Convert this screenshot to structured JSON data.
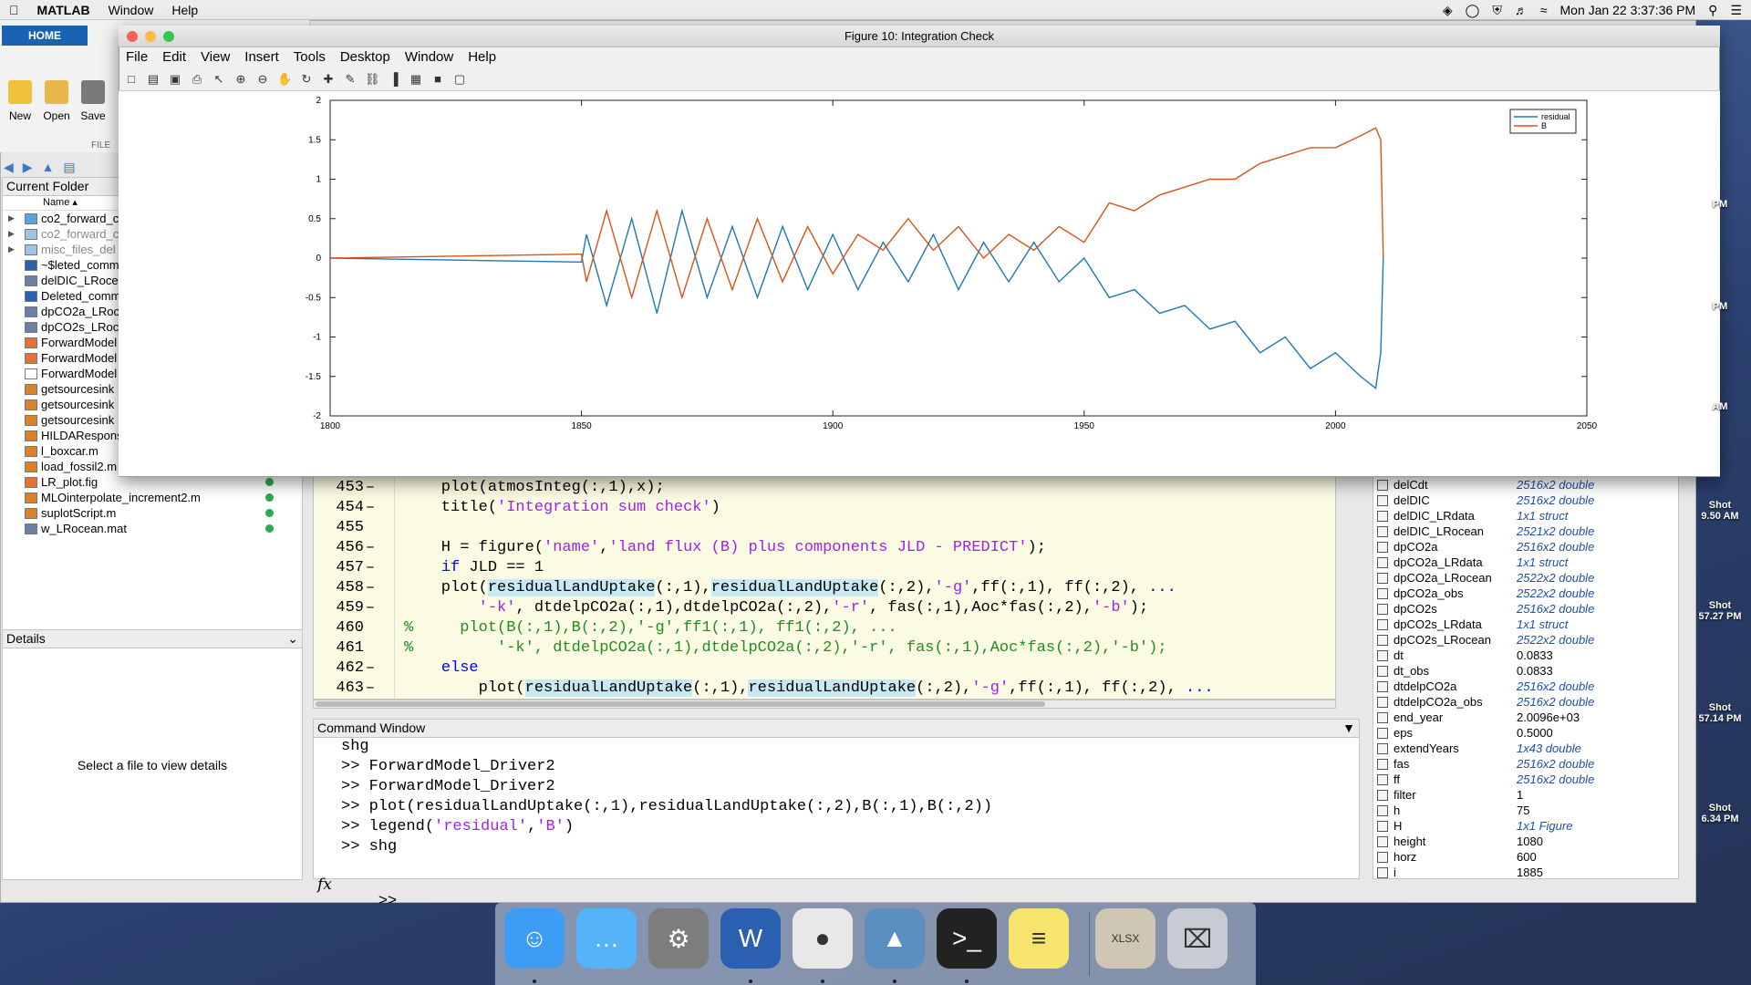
{
  "menubar": {
    "app": "MATLAB",
    "items": [
      "Window",
      "Help"
    ],
    "clock": "Mon Jan 22  3:37:36 PM"
  },
  "toolstrip": {
    "home_tab": "HOME",
    "new": "New",
    "open": "Open",
    "save": "Save",
    "file_section": "FILE"
  },
  "current_folder": {
    "title": "Current Folder",
    "name_header": "Name ▴",
    "files": [
      {
        "name": "co2_forward_c",
        "kind": "folder"
      },
      {
        "name": "co2_forward_c",
        "kind": "folder-gray"
      },
      {
        "name": "misc_files_del",
        "kind": "folder-gray"
      },
      {
        "name": "~$leted_comm",
        "kind": "word"
      },
      {
        "name": "delDIC_LRocea",
        "kind": "mat"
      },
      {
        "name": "Deleted_comm",
        "kind": "word"
      },
      {
        "name": "dpCO2a_LRoc",
        "kind": "mat"
      },
      {
        "name": "dpCO2s_LRoc",
        "kind": "mat"
      },
      {
        "name": "ForwardModel",
        "kind": "fig"
      },
      {
        "name": "ForwardModel",
        "kind": "fig"
      },
      {
        "name": "ForwardModel",
        "kind": "file"
      },
      {
        "name": "getsourcesink",
        "kind": "m"
      },
      {
        "name": "getsourcesink",
        "kind": "m"
      },
      {
        "name": "getsourcesink",
        "kind": "m"
      },
      {
        "name": "HILDARespons",
        "kind": "m"
      },
      {
        "name": "l_boxcar.m",
        "kind": "m"
      },
      {
        "name": "load_fossil2.m",
        "kind": "m"
      },
      {
        "name": "LR_plot.fig",
        "kind": "fig"
      },
      {
        "name": "MLOinterpolate_increment2.m",
        "kind": "m"
      },
      {
        "name": "suplotScript.m",
        "kind": "m"
      },
      {
        "name": "w_LRocean.mat",
        "kind": "mat"
      }
    ],
    "details_title": "Details",
    "details_text": "Select a file to view details"
  },
  "figure": {
    "window_title": "Figure 10: Integration Check",
    "menu": [
      "File",
      "Edit",
      "View",
      "Insert",
      "Tools",
      "Desktop",
      "Window",
      "Help"
    ],
    "toolbar_icons": [
      "new-figure-icon",
      "open-icon",
      "save-icon",
      "print-icon",
      "pointer-icon",
      "zoom-in-icon",
      "zoom-out-icon",
      "pan-icon",
      "rotate-icon",
      "data-cursor-icon",
      "brush-icon",
      "link-icon",
      "colorbar-icon",
      "legend-icon",
      "hide-tools-icon",
      "show-tools-icon"
    ]
  },
  "chart_data": {
    "type": "line",
    "xlim": [
      1800,
      2050
    ],
    "ylim": [
      -2,
      2
    ],
    "x_ticks": [
      "1800",
      "1850",
      "1900",
      "1950",
      "2000",
      "2050"
    ],
    "y_ticks": [
      "2",
      "1.5",
      "1",
      "0.5",
      "0",
      "-0.5",
      "-1",
      "-1.5",
      "-2"
    ],
    "grid": false,
    "legend_position": "top-right",
    "series": [
      {
        "name": "residual",
        "color": "#1f77b4",
        "x": [
          1800,
          1850,
          1851,
          1855,
          1860,
          1865,
          1870,
          1875,
          1880,
          1885,
          1890,
          1895,
          1900,
          1905,
          1910,
          1915,
          1920,
          1925,
          1930,
          1935,
          1940,
          1945,
          1950,
          1955,
          1960,
          1965,
          1970,
          1975,
          1980,
          1985,
          1990,
          1995,
          2000,
          2005,
          2008,
          2009,
          2009.5
        ],
        "y": [
          0,
          -0.05,
          0.3,
          -0.6,
          0.5,
          -0.7,
          0.6,
          -0.5,
          0.4,
          -0.5,
          0.4,
          -0.4,
          0.3,
          -0.4,
          0.2,
          -0.3,
          0.3,
          -0.4,
          0.2,
          -0.3,
          0.2,
          -0.3,
          0.0,
          -0.5,
          -0.4,
          -0.7,
          -0.6,
          -0.9,
          -0.8,
          -1.2,
          -1.0,
          -1.4,
          -1.2,
          -1.5,
          -1.65,
          -1.2,
          0.0
        ]
      },
      {
        "name": "B",
        "color": "#d95319",
        "x": [
          1800,
          1850,
          1851,
          1855,
          1860,
          1865,
          1870,
          1875,
          1880,
          1885,
          1890,
          1895,
          1900,
          1905,
          1910,
          1915,
          1920,
          1925,
          1930,
          1935,
          1940,
          1945,
          1950,
          1955,
          1960,
          1965,
          1970,
          1975,
          1980,
          1985,
          1990,
          1995,
          2000,
          2005,
          2008,
          2009,
          2009.5
        ],
        "y": [
          0,
          0.05,
          -0.3,
          0.6,
          -0.5,
          0.6,
          -0.5,
          0.5,
          -0.4,
          0.5,
          -0.3,
          0.4,
          -0.2,
          0.3,
          0.1,
          0.5,
          0.1,
          0.4,
          0.0,
          0.3,
          0.1,
          0.4,
          0.2,
          0.7,
          0.6,
          0.8,
          0.9,
          1.0,
          1.0,
          1.2,
          1.3,
          1.4,
          1.4,
          1.55,
          1.65,
          1.5,
          0.0
        ]
      }
    ]
  },
  "editor": {
    "lines": [
      {
        "num": "453",
        "segs": [
          {
            "t": "    plot(atmosInteg(:,1),x);",
            "c": ""
          }
        ]
      },
      {
        "num": "454",
        "segs": [
          {
            "t": "    title(",
            "c": ""
          },
          {
            "t": "'Integration sum check'",
            "c": "str"
          },
          {
            "t": ")",
            "c": ""
          }
        ]
      },
      {
        "num": "455",
        "segs": [
          {
            "t": "",
            "c": ""
          }
        ]
      },
      {
        "num": "456",
        "segs": [
          {
            "t": "    H = figure(",
            "c": ""
          },
          {
            "t": "'name'",
            "c": "str"
          },
          {
            "t": ",",
            "c": ""
          },
          {
            "t": "'land flux (B) plus components JLD - PREDICT'",
            "c": "str"
          },
          {
            "t": ");",
            "c": ""
          }
        ]
      },
      {
        "num": "457",
        "segs": [
          {
            "t": "    ",
            "c": ""
          },
          {
            "t": "if",
            "c": "kw"
          },
          {
            "t": " JLD == 1",
            "c": ""
          }
        ]
      },
      {
        "num": "458",
        "segs": [
          {
            "t": "    plot(",
            "c": ""
          },
          {
            "t": "residualLandUptake",
            "c": "hl"
          },
          {
            "t": "(:,1),",
            "c": ""
          },
          {
            "t": "residualLandUptake",
            "c": "hl"
          },
          {
            "t": "(:,2),",
            "c": ""
          },
          {
            "t": "'-g'",
            "c": "str"
          },
          {
            "t": ",ff(:,1), ff(:,2), ",
            "c": ""
          },
          {
            "t": "...",
            "c": "kw"
          }
        ]
      },
      {
        "num": "459",
        "segs": [
          {
            "t": "        ",
            "c": ""
          },
          {
            "t": "'-k'",
            "c": "str"
          },
          {
            "t": ", dtdelpCO2a(:,1),dtdelpCO2a(:,2),",
            "c": ""
          },
          {
            "t": "'-r'",
            "c": "str"
          },
          {
            "t": ", fas(:,1),Aoc*fas(:,2),",
            "c": ""
          },
          {
            "t": "'-b'",
            "c": "str"
          },
          {
            "t": ");",
            "c": ""
          }
        ]
      },
      {
        "num": "460",
        "segs": [
          {
            "t": "%     plot(B(:,1),B(:,2),'-g',ff1(:,1), ff1(:,2), ...",
            "c": "cmt"
          }
        ]
      },
      {
        "num": "461",
        "segs": [
          {
            "t": "%         '-k', dtdelpCO2a(:,1),dtdelpCO2a(:,2),'-r', fas(:,1),Aoc*fas(:,2),'-b');",
            "c": "cmt"
          }
        ]
      },
      {
        "num": "462",
        "segs": [
          {
            "t": "    ",
            "c": ""
          },
          {
            "t": "else",
            "c": "kw"
          }
        ]
      },
      {
        "num": "463",
        "segs": [
          {
            "t": "        plot(",
            "c": ""
          },
          {
            "t": "residualLandUptake",
            "c": "hl"
          },
          {
            "t": "(:,1),",
            "c": ""
          },
          {
            "t": "residualLandUptake",
            "c": "hl"
          },
          {
            "t": "(:,2),",
            "c": ""
          },
          {
            "t": "'-g'",
            "c": "str"
          },
          {
            "t": ",ff(:,1), ff(:,2), ",
            "c": ""
          },
          {
            "t": "...",
            "c": "kw"
          }
        ]
      }
    ]
  },
  "command_window": {
    "title": "Command Window",
    "lines": [
      {
        "segs": [
          {
            "t": "shg",
            "c": ""
          }
        ]
      },
      {
        "segs": [
          {
            "t": ">> ForwardModel_Driver2",
            "c": ""
          }
        ]
      },
      {
        "segs": [
          {
            "t": ">> ForwardModel_Driver2",
            "c": ""
          }
        ]
      },
      {
        "segs": [
          {
            "t": ">> plot(residualLandUptake(:,1),residualLandUptake(:,2),B(:,1),B(:,2))",
            "c": ""
          }
        ]
      },
      {
        "segs": [
          {
            "t": ">> legend(",
            "c": ""
          },
          {
            "t": "'residual'",
            "c": "str"
          },
          {
            "t": ",",
            "c": ""
          },
          {
            "t": "'B'",
            "c": "str"
          },
          {
            "t": ")",
            "c": ""
          }
        ]
      },
      {
        "segs": [
          {
            "t": ">> shg",
            "c": ""
          }
        ]
      }
    ],
    "prompt": ">>",
    "fx": "fx"
  },
  "workspace": {
    "vars": [
      {
        "name": "delCdt",
        "value": "2516x2 double",
        "italic": true
      },
      {
        "name": "delDIC",
        "value": "2516x2 double",
        "italic": true
      },
      {
        "name": "delDIC_LRdata",
        "value": "1x1 struct",
        "italic": true
      },
      {
        "name": "delDIC_LRocean",
        "value": "2521x2 double",
        "italic": true
      },
      {
        "name": "dpCO2a",
        "value": "2516x2 double",
        "italic": true
      },
      {
        "name": "dpCO2a_LRdata",
        "value": "1x1 struct",
        "italic": true
      },
      {
        "name": "dpCO2a_LRocean",
        "value": "2522x2 double",
        "italic": true
      },
      {
        "name": "dpCO2a_obs",
        "value": "2522x2 double",
        "italic": true
      },
      {
        "name": "dpCO2s",
        "value": "2516x2 double",
        "italic": true
      },
      {
        "name": "dpCO2s_LRdata",
        "value": "1x1 struct",
        "italic": true
      },
      {
        "name": "dpCO2s_LRocean",
        "value": "2522x2 double",
        "italic": true
      },
      {
        "name": "dt",
        "value": "0.0833",
        "italic": false
      },
      {
        "name": "dt_obs",
        "value": "0.0833",
        "italic": false
      },
      {
        "name": "dtdelpCO2a",
        "value": "2516x2 double",
        "italic": true
      },
      {
        "name": "dtdelpCO2a_obs",
        "value": "2516x2 double",
        "italic": true
      },
      {
        "name": "end_year",
        "value": "2.0096e+03",
        "italic": false
      },
      {
        "name": "eps",
        "value": "0.5000",
        "italic": false
      },
      {
        "name": "extendYears",
        "value": "1x43 double",
        "italic": true
      },
      {
        "name": "fas",
        "value": "2516x2 double",
        "italic": true
      },
      {
        "name": "ff",
        "value": "2516x2 double",
        "italic": true
      },
      {
        "name": "filter",
        "value": "1",
        "italic": false
      },
      {
        "name": "h",
        "value": "75",
        "italic": false
      },
      {
        "name": "H",
        "value": "1x1 Figure",
        "italic": true
      },
      {
        "name": "height",
        "value": "1080",
        "italic": false
      },
      {
        "name": "horz",
        "value": "600",
        "italic": false
      },
      {
        "name": "i",
        "value": "1885",
        "italic": false
      }
    ]
  },
  "desktop": {
    "shots": [
      {
        "l1": "",
        "l2": "PM"
      },
      {
        "l1": "",
        "l2": "PM"
      },
      {
        "l1": "",
        "l2": "AM"
      },
      {
        "l1": "Shot",
        "l2": "9.50 AM"
      },
      {
        "l1": "Shot",
        "l2": "57.27 PM"
      },
      {
        "l1": "Shot",
        "l2": "57.14 PM"
      },
      {
        "l1": "Shot",
        "l2": "6.34 PM"
      }
    ]
  },
  "dock": {
    "apps": [
      {
        "name": "finder-icon",
        "glyph": "☺",
        "bg": "#3d9df5",
        "dot": true
      },
      {
        "name": "messages-icon",
        "glyph": "…",
        "bg": "#54b4f7",
        "dot": false
      },
      {
        "name": "system-preferences-icon",
        "glyph": "⚙",
        "bg": "#7d7d7d",
        "dot": false
      },
      {
        "name": "word-icon",
        "glyph": "W",
        "bg": "#2b5fb0",
        "dot": true
      },
      {
        "name": "chrome-icon",
        "glyph": "●",
        "bg": "#e8e8e8",
        "dot": true
      },
      {
        "name": "matlab-icon",
        "glyph": "▲",
        "bg": "#5a8fc0",
        "dot": true
      },
      {
        "name": "terminal-icon",
        "glyph": ">_",
        "bg": "#222222",
        "dot": true
      },
      {
        "name": "notes-icon",
        "glyph": "≡",
        "bg": "#f7e46c",
        "dot": false
      },
      {
        "name": "xlsx-file-icon",
        "glyph": "XLSX",
        "bg": "#cfc6b4",
        "dot": false
      },
      {
        "name": "trash-icon",
        "glyph": "⌧",
        "bg": "#c8ccd2",
        "dot": false
      }
    ]
  }
}
